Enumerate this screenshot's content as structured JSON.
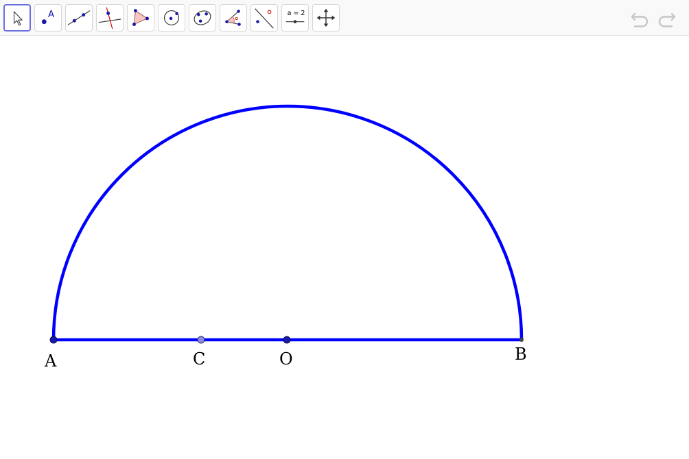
{
  "toolbar": {
    "tools": [
      {
        "id": "move",
        "icon": "move-arrow-icon",
        "active": true
      },
      {
        "id": "point",
        "icon": "point-icon",
        "label": "A"
      },
      {
        "id": "line",
        "icon": "line-icon"
      },
      {
        "id": "perpendicular",
        "icon": "perpendicular-line-icon"
      },
      {
        "id": "polygon",
        "icon": "polygon-icon"
      },
      {
        "id": "circle",
        "icon": "circle-center-point-icon"
      },
      {
        "id": "ellipse",
        "icon": "ellipse-icon"
      },
      {
        "id": "angle",
        "icon": "angle-icon"
      },
      {
        "id": "reflect",
        "icon": "reflect-icon"
      },
      {
        "id": "slider",
        "icon": "slider-icon",
        "label": "a = 2"
      },
      {
        "id": "move-graphics",
        "icon": "move-graphics-view-icon"
      }
    ],
    "undo_icon": "undo-icon",
    "redo_icon": "redo-icon"
  },
  "construction": {
    "colors": {
      "object": "#0000ff",
      "point": "#1a1aa6",
      "point_c": "#8a8ae0",
      "point_b": "#444444",
      "polygon_fill": "#f4c7c0",
      "accent_red": "#cc0000"
    },
    "points": {
      "A": {
        "label": "A"
      },
      "B": {
        "label": "B"
      },
      "C": {
        "label": "C"
      },
      "O": {
        "label": "O"
      }
    }
  }
}
